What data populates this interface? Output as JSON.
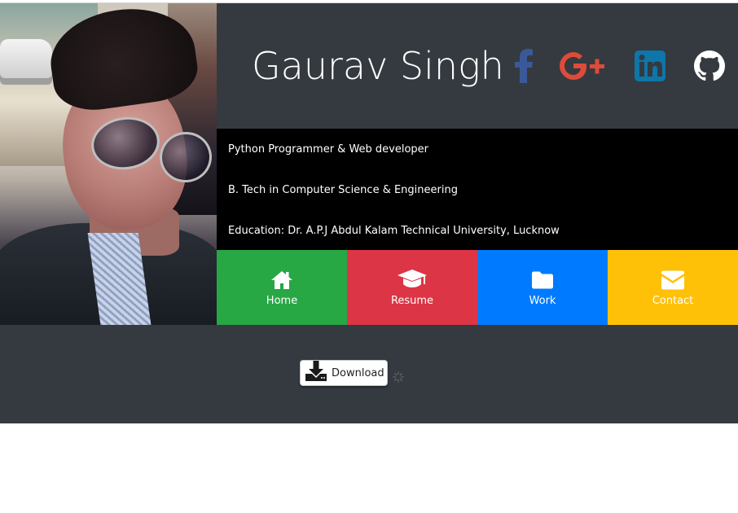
{
  "header": {
    "name": "Gaurav Singh",
    "social": [
      {
        "icon": "facebook-icon",
        "color": "#3b5998"
      },
      {
        "icon": "google-plus-icon",
        "color": "#dd4b39"
      },
      {
        "icon": "linkedin-icon",
        "color": "#0e76a8"
      },
      {
        "icon": "github-icon",
        "color": "#ffffff"
      }
    ]
  },
  "info": {
    "lines": [
      "Python Programmer & Web developer",
      "B. Tech in Computer Science & Engineering",
      "Education: Dr. A.P.J Abdul Kalam Technical University, Lucknow"
    ]
  },
  "nav": [
    {
      "label": "Home",
      "icon": "home-icon",
      "color": "#28a745"
    },
    {
      "label": "Resume",
      "icon": "graduation-cap-icon",
      "color": "#dc3545"
    },
    {
      "label": "Work",
      "icon": "folder-icon",
      "color": "#007bff"
    },
    {
      "label": "Contact",
      "icon": "envelope-icon",
      "color": "#ffc107"
    }
  ],
  "download": {
    "label": "Download",
    "icon": "download-icon"
  },
  "colors": {
    "dark_band": "#343a40",
    "info_band": "#000000"
  }
}
